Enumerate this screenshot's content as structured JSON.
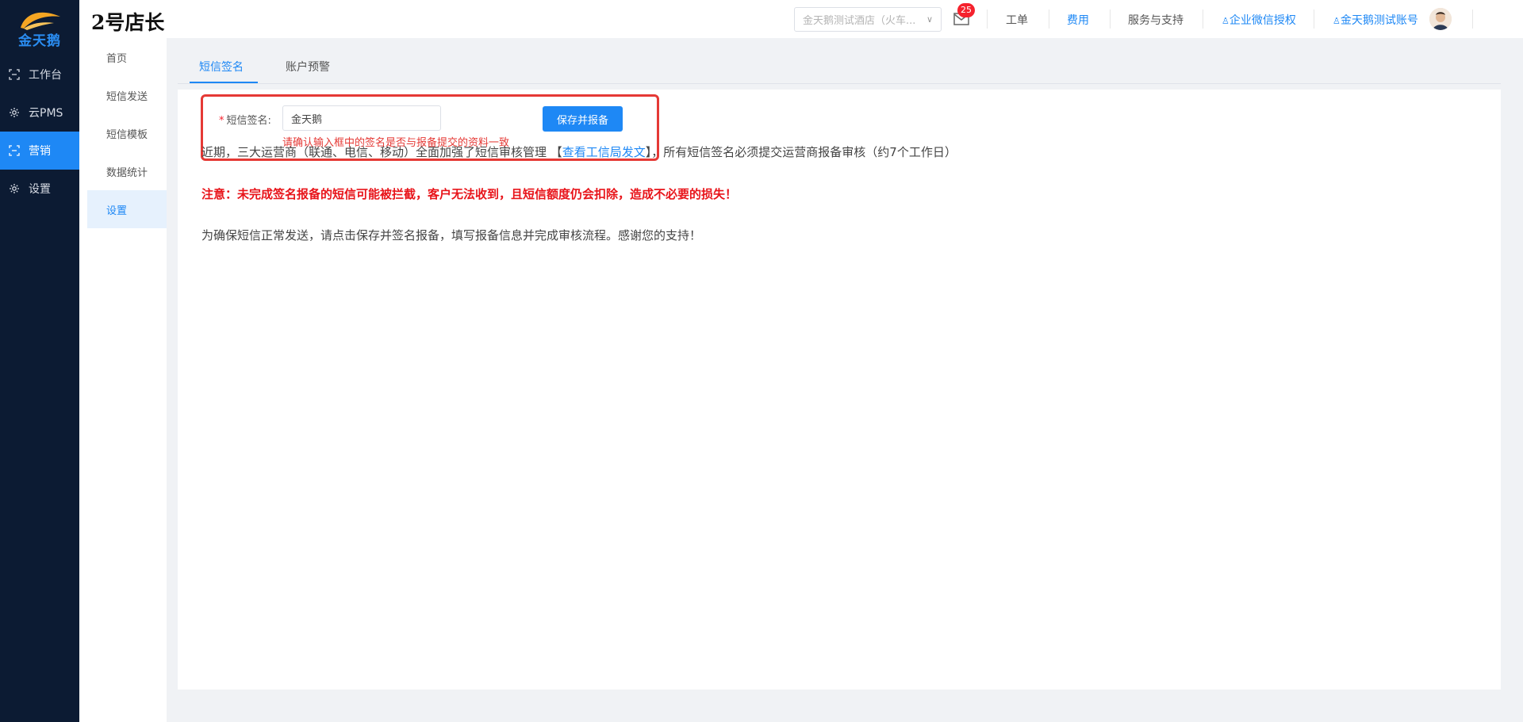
{
  "brand": {
    "logo_text": "金天鹅",
    "accent": "#1e88f5",
    "sidebar_bg": "#0c1b33"
  },
  "sidebar": {
    "items": [
      {
        "label": "工作台",
        "icon": "workbench-icon",
        "active": false
      },
      {
        "label": "云PMS",
        "icon": "gear-icon",
        "active": false
      },
      {
        "label": "营销",
        "icon": "marketing-icon",
        "active": true
      },
      {
        "label": "设置",
        "icon": "gear-icon",
        "active": false
      }
    ]
  },
  "header": {
    "app_title": "2号店长",
    "hotel_select": "金天鹅测试酒店（火车...",
    "mail_badge": "25",
    "links": {
      "ticket": "工单",
      "fees": "费用",
      "support": "服务与支持",
      "wechat_auth": "企业微信授权",
      "account": "金天鹅测试账号"
    }
  },
  "submenu": {
    "items": [
      {
        "label": "首页",
        "active": false
      },
      {
        "label": "短信发送",
        "active": false
      },
      {
        "label": "短信模板",
        "active": false
      },
      {
        "label": "数据统计",
        "active": false
      },
      {
        "label": "设置",
        "active": true
      }
    ]
  },
  "tabs": [
    {
      "label": "短信签名",
      "active": true
    },
    {
      "label": "账户预警",
      "active": false
    }
  ],
  "form": {
    "label": "短信签名:",
    "required_mark": "*",
    "value": "金天鹅",
    "hint": "请确认输入框中的签名是否与报备提交的资料一致",
    "save_button": "保存并报备"
  },
  "notice": {
    "line1_before": "近期，三大运营商（联通、电信、移动）全面加强了短信审核管理 【",
    "line1_link": "查看工信局发文",
    "line1_after": "】，所有短信签名必须提交运营商报备审核（约7个工作日）",
    "warning": "注意：未完成签名报备的短信可能被拦截，客户无法收到，且短信额度仍会扣除，造成不必要的损失！",
    "line3": "为确保短信正常发送，请点击保存并签名报备，填写报备信息并完成审核流程。感谢您的支持！"
  }
}
